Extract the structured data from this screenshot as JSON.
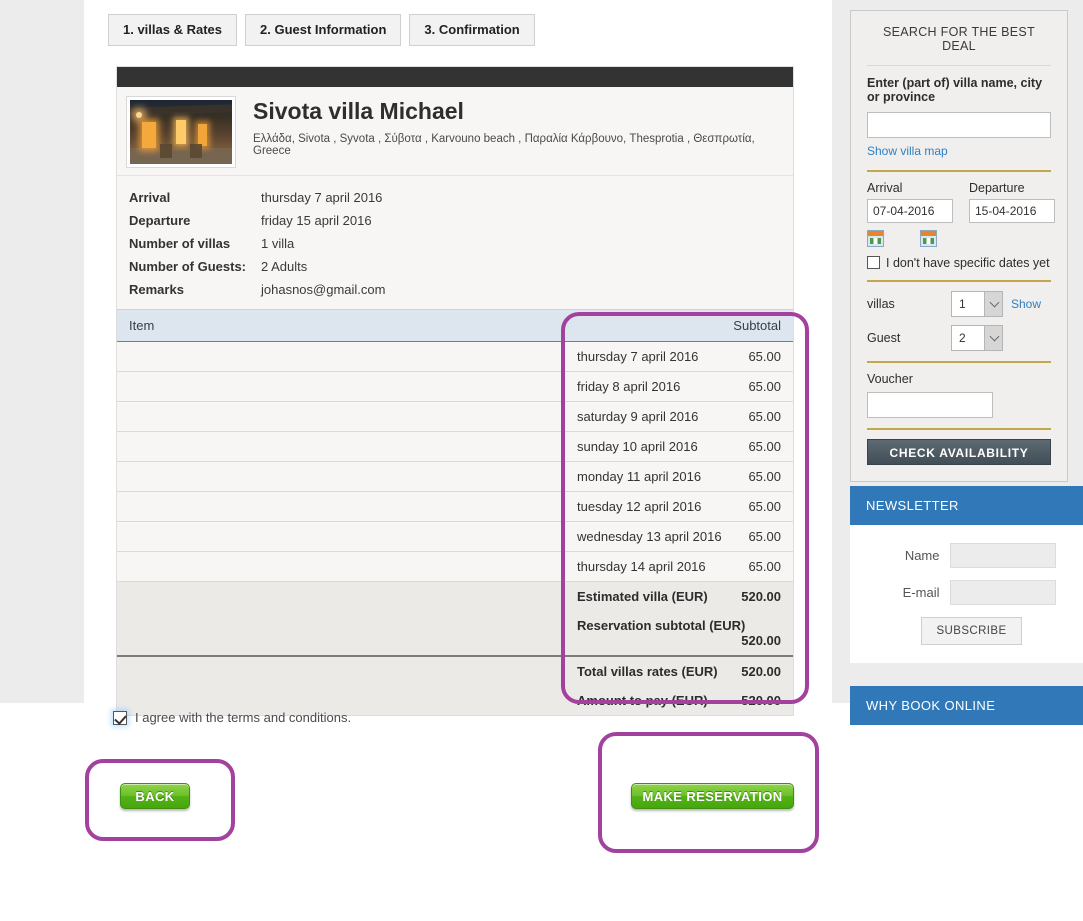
{
  "steps": [
    {
      "label": "1. villas & Rates"
    },
    {
      "label": "2. Guest Information"
    },
    {
      "label": "3. Confirmation"
    }
  ],
  "villa": {
    "name": "Sivota villa Michael",
    "location": "Ελλάδα, Sivota , Syvota , Σύβοτα , Karvouno beach , Παραλία Κάρβουνο, Thesprotia , Θεσπρωτία, Greece",
    "thumb_alt": "villa-photo"
  },
  "details": [
    {
      "label": "Arrival",
      "value": "thursday 7 april 2016"
    },
    {
      "label": "Departure",
      "value": "friday 15 april 2016"
    },
    {
      "label": "Number of villas",
      "value": "1 villa"
    },
    {
      "label": "Number of Guests:",
      "value": "2 Adults"
    },
    {
      "label": "Remarks",
      "value": "johasnos@gmail.com"
    }
  ],
  "items_table": {
    "header_item": "Item",
    "header_subtotal": "Subtotal",
    "rows": [
      {
        "label": "thursday 7 april 2016",
        "amount": "65.00"
      },
      {
        "label": "friday 8 april 2016",
        "amount": "65.00"
      },
      {
        "label": "saturday 9 april 2016",
        "amount": "65.00"
      },
      {
        "label": "sunday 10 april 2016",
        "amount": "65.00"
      },
      {
        "label": "monday 11 april 2016",
        "amount": "65.00"
      },
      {
        "label": "tuesday 12 april 2016",
        "amount": "65.00"
      },
      {
        "label": "wednesday 13 april 2016",
        "amount": "65.00"
      },
      {
        "label": "thursday 14 april 2016",
        "amount": "65.00"
      }
    ],
    "summary": [
      {
        "label": "Estimated villa (EUR)",
        "amount": "520.00"
      },
      {
        "label": "Reservation subtotal (EUR)",
        "amount": "520.00"
      }
    ],
    "totals": [
      {
        "label": "Total villas rates (EUR)",
        "amount": "520.00"
      },
      {
        "label": "Amount to pay (EUR)",
        "amount": "520.00"
      }
    ]
  },
  "terms": {
    "label": "I agree with the terms and conditions.",
    "checked": true
  },
  "actions": {
    "back_label": "BACK",
    "make_reservation_label": "MAKE RESERVATION"
  },
  "sidebar": {
    "search": {
      "title": "SEARCH FOR THE BEST DEAL",
      "name_label": "Enter (part of) villa name, city or province",
      "name_value": "",
      "name_placeholder": "",
      "show_map_link": "Show villa map",
      "arrival_label": "Arrival",
      "departure_label": "Departure",
      "arrival_value": "07-04-2016",
      "departure_value": "15-04-2016",
      "no_dates_label": "I don't have specific dates yet",
      "villas_label": "villas",
      "villas_value": "1",
      "show_link": "Show",
      "guest_label": "Guest",
      "guest_value": "2",
      "voucher_label": "Voucher",
      "voucher_value": "",
      "check_availability_label": "CHECK AVAILABILITY"
    },
    "newsletter": {
      "title": "NEWSLETTER",
      "name_label": "Name",
      "name_value": "",
      "email_label": "E-mail",
      "email_value": "",
      "subscribe_label": "SUBSCRIBE"
    },
    "why_book": {
      "title": "WHY BOOK ONLINE"
    }
  },
  "colors": {
    "highlight": "#a2419e",
    "panel_blue": "#3178b8",
    "button_green": "#52b215",
    "gold_rule": "#c2a74b"
  }
}
